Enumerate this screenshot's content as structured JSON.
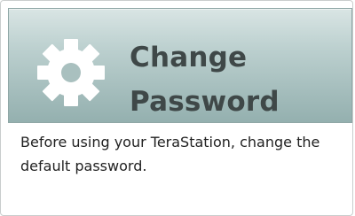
{
  "card": {
    "title_line1": "Change",
    "title_line2": "Password",
    "description": "Before using your TeraStation, change the default password.",
    "icon": "gear-icon"
  },
  "colors": {
    "header_gradient_top": "#d9e5e4",
    "header_gradient_bottom": "#94b0af",
    "title_text": "#3f4848",
    "icon_fill": "#ffffff"
  }
}
